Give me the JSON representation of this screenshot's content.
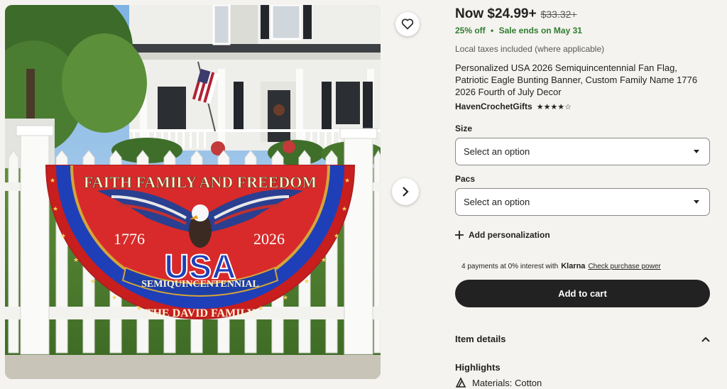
{
  "price": {
    "current": "Now $24.99+",
    "original": "$33.32+",
    "discount": "25% off",
    "separator": "•",
    "sale_ends": "Sale ends on May 31",
    "tax_note": "Local taxes included (where applicable)"
  },
  "product": {
    "title": "Personalized USA 2026 Semiquincentennial Fan Flag, Patriotic Eagle Bunting Banner, Custom Family Name 1776 2026 Fourth of July Decor",
    "shop": "HavenCrochetGifts",
    "rating_stars": "★★★★☆"
  },
  "image": {
    "banner_top": "FAITH FAMILY AND FREEDOM",
    "year_left": "1776",
    "year_right": "2026",
    "usa": "USA",
    "ribbon": "SEMIQUINCENTENNIAL",
    "family": "THE DAVID FAMILY"
  },
  "options": {
    "size_label": "Size",
    "size_value": "Select an option",
    "pacs_label": "Pacs",
    "pacs_value": "Select an option"
  },
  "personalization": {
    "label": "Add personalization"
  },
  "klarna": {
    "text": "4 payments at 0% interest with",
    "brand": "Klarna",
    "link": "Check purchase power"
  },
  "cart": {
    "label": "Add to cart"
  },
  "details": {
    "title": "Item details",
    "highlights": "Highlights",
    "material": "Materials: Cotton"
  },
  "colors": {
    "sale_green": "#2f7d32",
    "button_dark": "#222222",
    "background": "#f5f3ef"
  },
  "icons": [
    "heart-icon",
    "chevron-right-icon",
    "plus-icon",
    "chevron-up-icon",
    "caret-down-icon",
    "material-icon",
    "star-icon"
  ]
}
